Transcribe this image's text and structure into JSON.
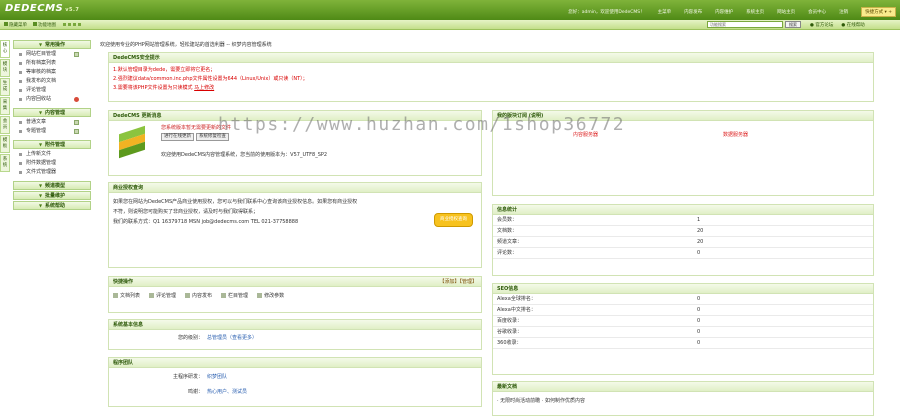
{
  "app": {
    "logo": "DEDECMS",
    "version": "v5.7"
  },
  "top": {
    "user_text": "您好：admin，欢迎使用DedeCMS！",
    "nav": [
      "主菜单",
      "内容发布",
      "内容维护",
      "系统主页",
      "网站主页",
      "会员中心",
      "注销"
    ],
    "quick_button": "快捷方式"
  },
  "bar2": {
    "tabs": [
      "隐藏菜单",
      "功能地图"
    ],
    "search_placeholder": "功能搜索",
    "search_button": "搜索",
    "links": [
      "官方论坛",
      "在线帮助"
    ]
  },
  "left_tabs": [
    "核心",
    "模块",
    "生成",
    "采集",
    "会员",
    "模板",
    "系统"
  ],
  "menu": {
    "sections": [
      {
        "title": "常用操作",
        "items": [
          "网站栏目管理",
          "所有档案列表",
          "等审核的档案",
          "我发布的文档",
          "评论管理",
          "内容回收站"
        ]
      },
      {
        "title": "内容管理",
        "items": [
          "普通文章",
          "专题管理"
        ]
      },
      {
        "title": "附件管理",
        "items": [
          "上传新文件",
          "附件数据管理",
          "文件式管理器"
        ]
      },
      {
        "title": "频道模型",
        "items": []
      },
      {
        "title": "批量维护",
        "items": []
      },
      {
        "title": "系统帮助",
        "items": []
      }
    ]
  },
  "breadcrumb": "欢迎使用专业的PHP网站管理系统，轻松建站的首选利器 -- 织梦内容管理系统",
  "security": {
    "title": "DedeCMS安全提示",
    "lines": [
      "1.默认管理目录为dede，需要立即将它更名；",
      "2.强烈建议data/common.inc.php文件属性设置为644（Linux/Unix）或只读（NT）；",
      "3.需要将该PHP文件设置为只读模式"
    ],
    "link": "马上修改"
  },
  "news": {
    "title": "DedeCMS 更新消息",
    "update_title": "您系统版本暂无需要更新的文件",
    "buttons": [
      "进行在线更新",
      "系统修复检查"
    ],
    "text": "欢迎使用DedeCMS内容管理系统，您当前的使用版本为：V57_UTF8_SP2"
  },
  "license": {
    "title": "商业授权查询",
    "lines": [
      "如果您在网站为DedeCMS产品商业使用授权，您可以与我们联系中心查询该商业授权信息。如果您有商业授权",
      "不符，则说明您可能购买了非商业授权，请及时与我们取得联系；",
      "我们的联系方式：Q1 16379718 MSN job@dedecms.com TEL 021-37758888"
    ],
    "button": "商业授权查询"
  },
  "quick": {
    "title": "快捷操作",
    "links_right": "【添加】【管理】",
    "items": [
      "文档列表",
      "评论管理",
      "内容发布",
      "栏目管理",
      "修改参数"
    ]
  },
  "sysinfo": {
    "title": "系统基本信息",
    "label": "您的级别：",
    "value": "总管理员（查看更多）"
  },
  "dev": {
    "title": "程序团队",
    "rows": [
      {
        "k": "主程序研发：",
        "v": "织梦团队"
      },
      {
        "k": "鸣谢：",
        "v": "热心用户、测试员"
      }
    ]
  },
  "trans": {
    "title": "我的版块订阅 (说明)",
    "left": "内容服务器",
    "right": "数据服务器"
  },
  "info": {
    "title": "信息统计",
    "rows": [
      {
        "k": "会员数：",
        "v": "1"
      },
      {
        "k": "文档数：",
        "v": "20"
      },
      {
        "k": "频道文章：",
        "v": "20"
      },
      {
        "k": "评论数：",
        "v": "0"
      }
    ]
  },
  "seo": {
    "title": "SEO信息",
    "rows": [
      {
        "k": "Alexa全球排名：",
        "v": "0"
      },
      {
        "k": "Alexa中文排名：",
        "v": "0"
      },
      {
        "k": "百度收录：",
        "v": "0"
      },
      {
        "k": "谷歌收录：",
        "v": "0"
      },
      {
        "k": "360收录：",
        "v": "0"
      }
    ]
  },
  "latest": {
    "title": "最新文档",
    "item": "· 无限时尚活动前瞻 · 如何制作优质内容"
  },
  "watermark": "https://www.huzhan.com/1shop36772"
}
